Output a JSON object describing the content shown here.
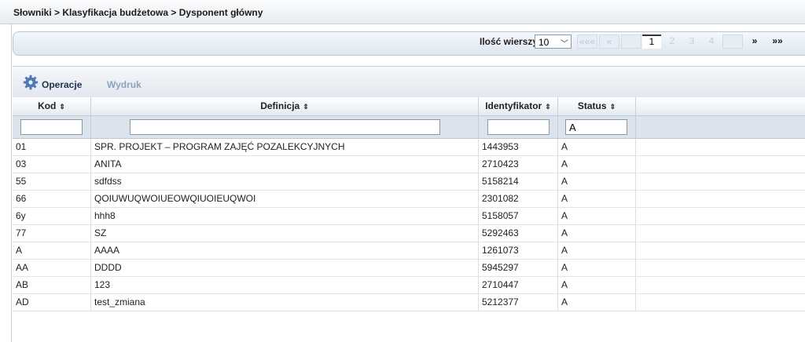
{
  "breadcrumb": "Słowniki > Klasyfikacja budżetowa > Dysponent główny",
  "pager": {
    "rows_label": "Ilość wierszy",
    "rows_value": "10",
    "first": "«««",
    "prev": "«",
    "pages": [
      "1",
      "2",
      "3",
      "4"
    ],
    "current": "1",
    "next": "»",
    "last": "»»"
  },
  "toolbar": {
    "operations_label": "Operacje",
    "print_label": "Wydruk"
  },
  "columns": [
    {
      "label": "Kod",
      "sort_icon": "⇕"
    },
    {
      "label": "Definicja",
      "sort_icon": "⇕"
    },
    {
      "label": "Identyfikator",
      "sort_icon": "⇕"
    },
    {
      "label": "Status",
      "sort_icon": "⇕"
    }
  ],
  "filters": {
    "kod": "",
    "definicja": "",
    "identyfikator": "",
    "status": "A"
  },
  "rows": [
    {
      "kod": "01",
      "definicja": "SPR. PROJEKT – PROGRAM ZAJĘĆ POZALEKCYJNYCH",
      "identyfikator": "1443953",
      "status": "A"
    },
    {
      "kod": "03",
      "definicja": "ANITA",
      "identyfikator": "2710423",
      "status": "A"
    },
    {
      "kod": "55",
      "definicja": "sdfdss",
      "identyfikator": "5158214",
      "status": "A"
    },
    {
      "kod": "66",
      "definicja": "QOIUWUQWOIUEOWQIUOIEUQWOI",
      "identyfikator": "2301082",
      "status": "A"
    },
    {
      "kod": "6y",
      "definicja": "hhh8",
      "identyfikator": "5158057",
      "status": "A"
    },
    {
      "kod": "77",
      "definicja": "SZ",
      "identyfikator": "5292463",
      "status": "A"
    },
    {
      "kod": "A",
      "definicja": "AAAA",
      "identyfikator": "1261073",
      "status": "A"
    },
    {
      "kod": "AA",
      "definicja": "DDDD",
      "identyfikator": "5945297",
      "status": "A"
    },
    {
      "kod": "AB",
      "definicja": "123",
      "identyfikator": "2710447",
      "status": "A"
    },
    {
      "kod": "AD",
      "definicja": "test_zmiana",
      "identyfikator": "5212377",
      "status": "A"
    }
  ]
}
